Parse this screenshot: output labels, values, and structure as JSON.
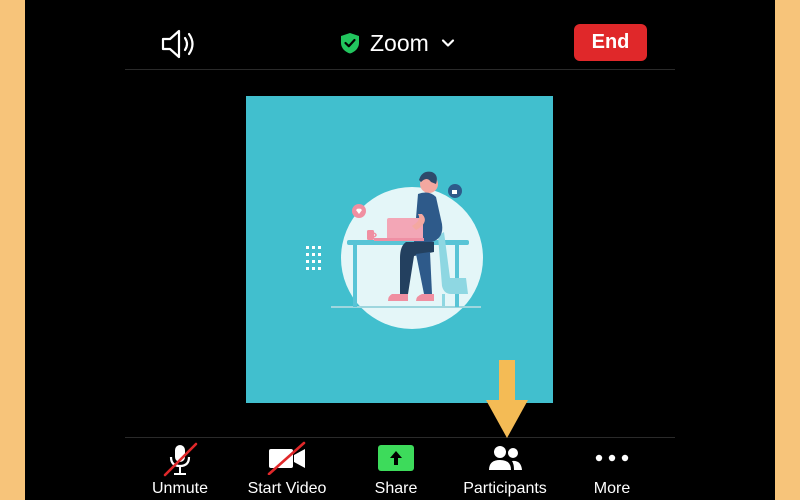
{
  "header": {
    "title": "Zoom",
    "end_label": "End"
  },
  "toolbar": {
    "items": [
      {
        "label": "Unmute",
        "icon": "mic-muted-icon"
      },
      {
        "label": "Start Video",
        "icon": "video-off-icon"
      },
      {
        "label": "Share",
        "icon": "share-icon"
      },
      {
        "label": "Participants",
        "icon": "participants-icon"
      },
      {
        "label": "More",
        "icon": "more-icon"
      }
    ]
  },
  "colors": {
    "background_frame": "#F7C47A",
    "end_button": "#E0282A",
    "share_green": "#3DDB5B",
    "video_tile": "#41BFCE",
    "arrow": "#F4BB55"
  }
}
